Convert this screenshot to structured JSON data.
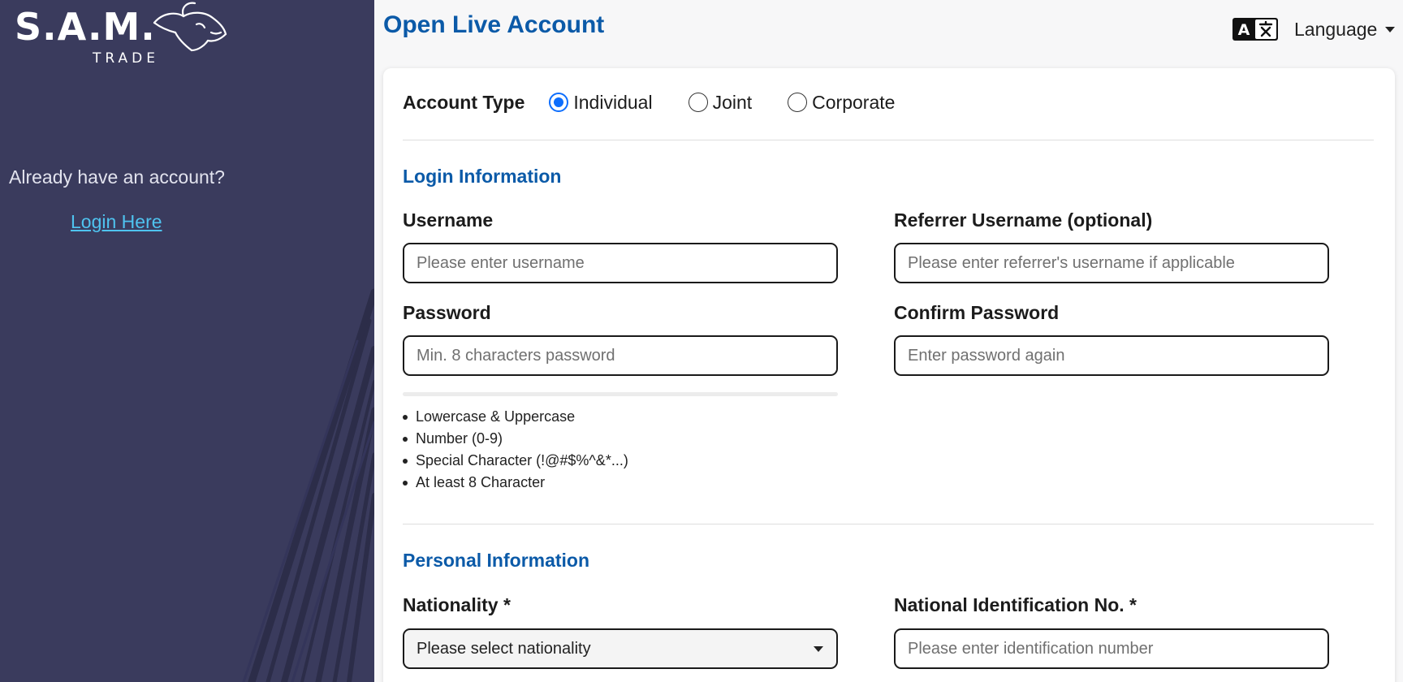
{
  "brand": {
    "logo_letters": "S.A.M.",
    "logo_sub": "TRADE"
  },
  "sidebar": {
    "already_text": "Already have an account?",
    "login_link": "Login Here"
  },
  "header": {
    "title": "Open Live Account",
    "language_label": "Language",
    "language_icon": "translate-icon"
  },
  "account_type": {
    "label": "Account Type",
    "options": [
      {
        "label": "Individual",
        "checked": true
      },
      {
        "label": "Joint",
        "checked": false
      },
      {
        "label": "Corporate",
        "checked": false
      }
    ]
  },
  "login_info": {
    "title": "Login Information",
    "username": {
      "label": "Username",
      "placeholder": "Please enter username",
      "value": ""
    },
    "referrer": {
      "label": "Referrer Username (optional)",
      "placeholder": "Please enter referrer's username if applicable",
      "value": ""
    },
    "password": {
      "label": "Password",
      "placeholder": "Min. 8 characters password",
      "value": ""
    },
    "confirm_password": {
      "label": "Confirm Password",
      "placeholder": "Enter password again",
      "value": ""
    },
    "password_rules": [
      "Lowercase & Uppercase",
      "Number (0-9)",
      "Special Character (!@#$%^&*...)",
      "At least 8 Character"
    ]
  },
  "personal_info": {
    "title": "Personal Information",
    "nationality": {
      "label": "Nationality *",
      "selected": "Please select nationality"
    },
    "national_id": {
      "label": "National Identification No. *",
      "placeholder": "Please enter identification number",
      "value": ""
    }
  },
  "colors": {
    "sidebar_bg": "#3a3b5d",
    "accent_blue": "#0b5aa8",
    "link_cyan": "#4fc3ef",
    "radio_blue": "#0d6efd"
  }
}
